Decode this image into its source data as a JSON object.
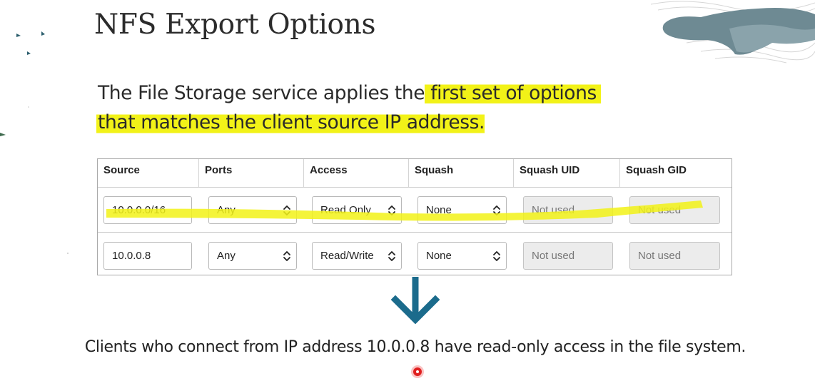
{
  "slide": {
    "title": "NFS Export Options",
    "intro": {
      "plain": "The File Storage service applies the",
      "highlighted_line1": " first set of options",
      "highlighted_line2": "that matches the client source IP address."
    },
    "conclusion": "Clients who connect from IP address 10.0.0.8 have read-only access in the file system.",
    "highlight_color": "#f2f218",
    "arrow_color": "#1b6b8c"
  },
  "table": {
    "headers": [
      "Source",
      "Ports",
      "Access",
      "Squash",
      "Squash UID",
      "Squash GID"
    ],
    "rows": [
      {
        "source": "10.0.0.0/16",
        "ports": "Any",
        "access": "Read Only",
        "squash": "None",
        "squash_uid": "Not used",
        "squash_gid": "Not used"
      },
      {
        "source": "10.0.0.8",
        "ports": "Any",
        "access": "Read/Write",
        "squash": "None",
        "squash_uid": "Not used",
        "squash_gid": "Not used"
      }
    ]
  }
}
